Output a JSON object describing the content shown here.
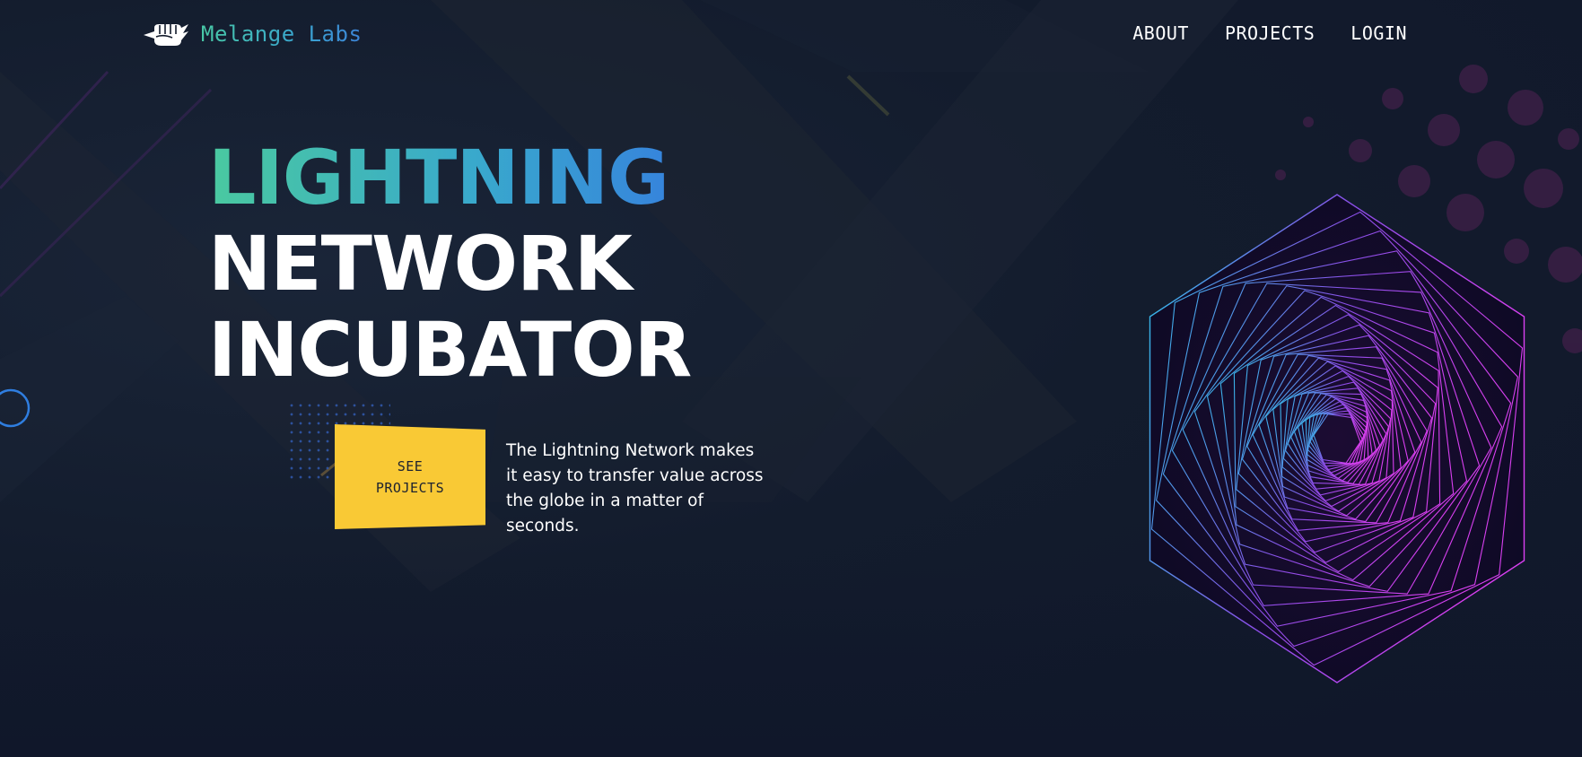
{
  "header": {
    "logo_text": "Melange Labs",
    "logo_icon": "fist-icon",
    "nav": [
      {
        "label": "ABOUT"
      },
      {
        "label": "PROJECTS"
      },
      {
        "label": "LOGIN"
      }
    ]
  },
  "hero": {
    "title_line1": "LIGHTNING",
    "title_line2": "NETWORK",
    "title_line3": "INCUBATOR",
    "cta_label": "SEE PROJECTS",
    "description": "The Lightning Network makes it easy to transfer value across the globe in a matter of seconds."
  },
  "colors": {
    "background": "#121a2b",
    "accent_yellow": "#f9c935",
    "gradient_teal": "#4ac9a0",
    "gradient_blue": "#3680de",
    "hex_cyan": "#2bc4e8",
    "hex_magenta": "#d83ff0"
  }
}
